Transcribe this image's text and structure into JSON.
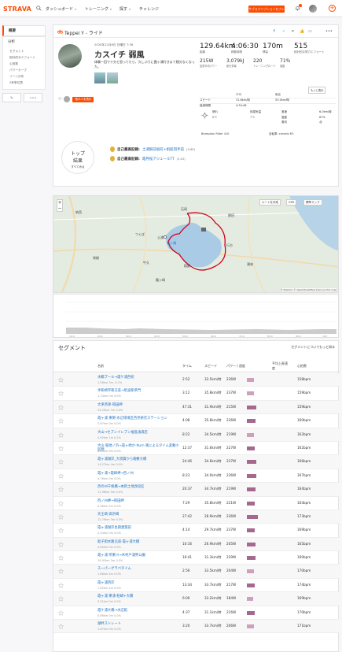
{
  "nav": {
    "logo": "STRAVA",
    "items": [
      "ダッシュボード",
      "トレーニング",
      "探す",
      "チャレンジ"
    ],
    "subscribe": "サブスクリプションをプレゼント"
  },
  "sidebar": {
    "items": [
      "概要",
      "分析"
    ],
    "subitems": [
      "セグメント",
      "相対的なエフォート",
      "心拍数",
      "パワーカーブ",
      "ゾーン分布",
      "2秒単位表"
    ],
    "edit": "✎",
    "more": "•••"
  },
  "activity": {
    "title": "Teppei Y - ライド",
    "date": "2020年12月6日 日曜日 7:38",
    "name": "カスイチ 弱風",
    "description": "体験一回で十分と思ってたら、久しぶりに霞ヶ浦行きまて随分なくなった。",
    "flag_button": "他の人を表示",
    "stats_big": [
      {
        "value": "129.64km",
        "label": "距離"
      },
      {
        "value": "4:06:30",
        "label": "移動時間"
      },
      {
        "value": "170m",
        "label": "標高"
      },
      {
        "value": "515",
        "label": "相対的な努力エフォート"
      }
    ],
    "stats_mid": [
      {
        "value": "215W",
        "label": "加重平均パワー"
      },
      {
        "value": "3,079kJ",
        "label": "総仕事量"
      },
      {
        "value": "220",
        "label": "トレーニングロード"
      },
      {
        "value": "71%",
        "label": "強度"
      }
    ],
    "more_btn": "もっと表示",
    "perf_headers": [
      "平均",
      "最高"
    ],
    "perf_rows": [
      {
        "label": "スピード",
        "avg": "31.6km/時",
        "max": "53.0km/時"
      },
      {
        "label": "経過時間",
        "avg": "4:34:48",
        "max": ""
      }
    ],
    "weather": {
      "headers": [
        "晴れ",
        "体感気温",
        "風速",
        "湿度",
        "風向"
      ],
      "values": [
        "6℃",
        "7℃",
        "6.0km/時",
        "67%",
        "北"
      ]
    },
    "device": "Brompton Rider 410",
    "bike": "自転車: cervelo R3"
  },
  "achievements": {
    "label1": "トップ",
    "label2": "結果",
    "link": "すべてみる",
    "items": [
      {
        "title": "自己最高記録:",
        "segment": "土浦駅前坂町+帆船羽手前",
        "time": "(3:45)"
      },
      {
        "title": "自己最高記録:",
        "segment": "霞月桜アジュールTT",
        "time": "(1:15)"
      }
    ]
  },
  "map": {
    "labels": [
      "霞ヶ浦",
      "つくば",
      "土浦",
      "石岡",
      "鉾田",
      "行方",
      "稲敷",
      "潮来",
      "牛久",
      "筑西",
      "常総",
      "龍ヶ崎"
    ],
    "btn1": "ルートを作成",
    "btn2": "GPX",
    "btn3": "標準マップ",
    "credit": "© Mapbox © OpenStreetMap Improve this map"
  },
  "segments": {
    "title": "セグメント",
    "link": "セグメントについてもっと知る",
    "headers": [
      "名前",
      "タイム",
      "スピード",
      "パワー / 速度",
      "平均上昇速度",
      "心拍数"
    ],
    "rows": [
      {
        "name": "水郷ブール→霞ケ浦西校",
        "sub": "1.56km  3m  -0.1%",
        "time": "2:52",
        "speed": "33.5km/時",
        "power": "236W",
        "hr": "158bpm",
        "bar": 0.4
      },
      {
        "name": "手和崎平和交差→筑波新県門",
        "sub": "1.74km  0m  0.0%",
        "time": "3:12",
        "speed": "35.8km/時",
        "power": "237W",
        "hr": "159bpm",
        "bar": 0.4
      },
      {
        "name": "大津西津-和田岬",
        "sub": "25.25km  7m  0.0%",
        "time": "47:31",
        "speed": "31.9km/時",
        "power": "215W",
        "hr": "159bpm",
        "bar": 0.7
      },
      {
        "name": "霞ヶ浦 東側-水辺環境区西見研究ステーション",
        "sub": "2.67km  0m  0.0%",
        "time": "4:08",
        "speed": "35.8km/時",
        "power": "236W",
        "hr": "160bpm",
        "bar": 0.6
      },
      {
        "name": "大山→セブンイレブン福島浅満店",
        "sub": "4.92km  1m  0.1%",
        "time": "8:22",
        "speed": "34.5km/時",
        "power": "219W",
        "hr": "162bpm",
        "bar": 0.4
      },
      {
        "name": "大山 稲地ノ浜→霞ヶ崎か-Iturn 風によるタイム変動小区間",
        "sub": "6.83km  9m  0.0%",
        "time": "12:37",
        "speed": "31.6km/時",
        "power": "227W",
        "hr": "162bpm",
        "bar": 0.5
      },
      {
        "name": "霞ヶ浦湖岸_大須賀から稲敷大橋",
        "sub": "14.27km  4m  0.0%",
        "time": "24:46",
        "speed": "34.6km/時",
        "power": "237W",
        "hr": "166bpm",
        "bar": 0.7
      },
      {
        "name": "霞ヶ浦→霞崎岬→西ノ州",
        "sub": "4.76km  0m  0.0%",
        "time": "8:23",
        "speed": "34.0km/時",
        "power": "236W",
        "hr": "167bpm",
        "bar": 0.7
      },
      {
        "name": "西の州千帆橋→本新土地改良区",
        "sub": "11.96km  0m  0.0%",
        "time": "20:37",
        "speed": "34.7km/時",
        "power": "219W",
        "hr": "164bpm",
        "bar": 0.6
      },
      {
        "name": "西ノ州岬→和田岬",
        "sub": "4.46km  2m  0.0%",
        "time": "7:29",
        "speed": "35.8km/時",
        "power": "221W",
        "hr": "164bpm",
        "bar": 0.5
      },
      {
        "name": "天王崎-高浜崎",
        "sub": "12.79km  3m  0.0%",
        "time": "27:42",
        "speed": "28.9km/時",
        "power": "236W",
        "hr": "173bpm",
        "bar": 0.8
      },
      {
        "name": "霞ヶ浦湖岸長期建築前",
        "sub": "2.04km  0m  0.0%",
        "time": "4:14",
        "speed": "29.7km/時",
        "power": "237W",
        "hr": "169bpm",
        "bar": 0.5
      },
      {
        "name": "船子街水路沿道-霞ヶ浦大橋",
        "sub": "4.60km  0m  0.0%",
        "time": "10:16",
        "speed": "26.9km/時",
        "power": "205W",
        "hr": "165bpm",
        "bar": 0.6
      },
      {
        "name": "霞ヶ浦 県東川→木村戸浦界公園",
        "sub": "10.93km  3m  0.0%",
        "time": "16:41",
        "speed": "31.3km/時",
        "power": "229W",
        "hr": "160bpm",
        "bar": 0.6
      },
      {
        "name": "スーパーグラペタイム",
        "sub": "1.66km  4m  0.0%",
        "time": "2:56",
        "speed": "33.5km/時",
        "power": "204W",
        "hr": "170bpm",
        "bar": 0.4
      },
      {
        "name": "霞ヶ浦西岸",
        "sub": "7.62km  2m  0.0%",
        "time": "13:34",
        "speed": "33.7km/時",
        "power": "217W",
        "hr": "174bpm",
        "bar": 0.5
      },
      {
        "name": "霞ヶ浦 東浦-粕崎+大橋",
        "sub": "3.31km  0m  0.0%",
        "time": "6:00",
        "speed": "33.2km/時",
        "power": "184W",
        "hr": "169bpm",
        "bar": 0.3
      },
      {
        "name": "霞ケ浦大橋→水辺館",
        "sub": "0.66km  0m  0.0%",
        "time": "4:37",
        "speed": "31.1km/時",
        "power": "216W",
        "hr": "170bpm",
        "bar": 0.5
      },
      {
        "name": "湖畔ストレート",
        "sub": "1.87km  0m  0.0%",
        "time": "3:20",
        "speed": "33.7km/時",
        "power": "206W",
        "hr": "171bpm",
        "bar": 0.4
      }
    ]
  }
}
